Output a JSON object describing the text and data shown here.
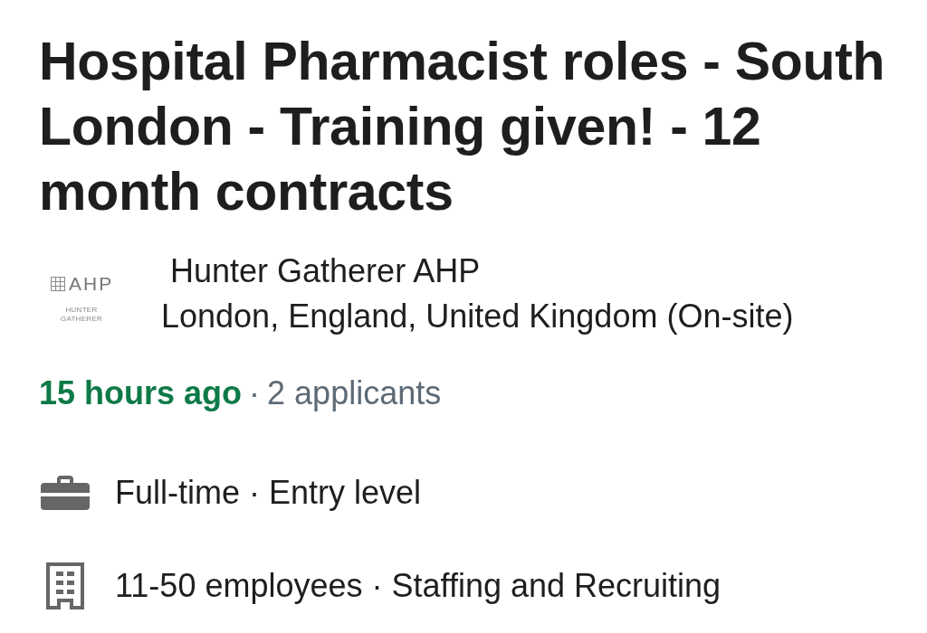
{
  "title": "Hospital Pharmacist roles - South London - Training given! - 12 month contracts",
  "company": {
    "logo": {
      "mark": "AHP",
      "lines": [
        "HUNTER",
        "GATHERER"
      ]
    },
    "name": "Hunter Gatherer AHP",
    "location": "London, England, United Kingdom (On-site)"
  },
  "activity": {
    "posted": "15 hours ago",
    "separator": "·",
    "applicants": "2 applicants"
  },
  "insights": [
    {
      "kind": "job-type",
      "text": "Full-time · Entry level"
    },
    {
      "kind": "company-size",
      "text": "11-50 employees · Staffing and Recruiting"
    }
  ]
}
